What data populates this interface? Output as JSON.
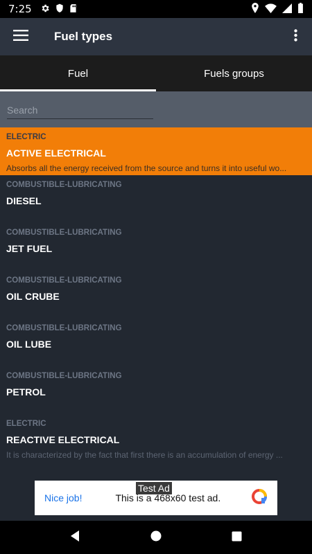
{
  "status_bar": {
    "time": "7:25",
    "left_icons": [
      "gear-icon",
      "shield-icon",
      "sd-card-icon"
    ],
    "right_icons": [
      "location-icon",
      "wifi-icon",
      "signal-icon",
      "battery-icon"
    ]
  },
  "app_bar": {
    "title": "Fuel types",
    "menu_icon": "menu-icon",
    "more_icon": "more-vert-icon"
  },
  "tabs": [
    {
      "label": "Fuel",
      "active": true
    },
    {
      "label": "Fuels groups",
      "active": false
    }
  ],
  "search": {
    "placeholder": "Search",
    "value": ""
  },
  "fuels": [
    {
      "category": "ELECTRIC",
      "name": "ACTIVE ELECTRICAL",
      "description": "Absorbs all the energy received from the source and turns it into useful wo...",
      "selected": true
    },
    {
      "category": "COMBUSTIBLE-LUBRICATING",
      "name": "DIESEL",
      "description": "",
      "selected": false
    },
    {
      "category": "COMBUSTIBLE-LUBRICATING",
      "name": "JET FUEL",
      "description": "",
      "selected": false
    },
    {
      "category": "COMBUSTIBLE-LUBRICATING",
      "name": "OIL CRUBE",
      "description": "",
      "selected": false
    },
    {
      "category": "COMBUSTIBLE-LUBRICATING",
      "name": "OIL LUBE",
      "description": "",
      "selected": false
    },
    {
      "category": "COMBUSTIBLE-LUBRICATING",
      "name": "PETROL",
      "description": "",
      "selected": false
    },
    {
      "category": "ELECTRIC",
      "name": "REACTIVE ELECTRICAL",
      "description": "It is characterized by the fact that first there is an accumulation of energy ...",
      "selected": false
    }
  ],
  "ad": {
    "label": "Test Ad",
    "nice": "Nice job!",
    "text": "This is a 468x60 test ad.",
    "icon": "ad-logo-icon"
  },
  "nav_bar": {
    "icons": [
      "back-icon",
      "home-icon",
      "recents-icon"
    ]
  },
  "colors": {
    "selected_bg": "#f27e08",
    "background": "#222831",
    "app_bar": "#2d3440",
    "ad_link": "#1a73e8"
  }
}
